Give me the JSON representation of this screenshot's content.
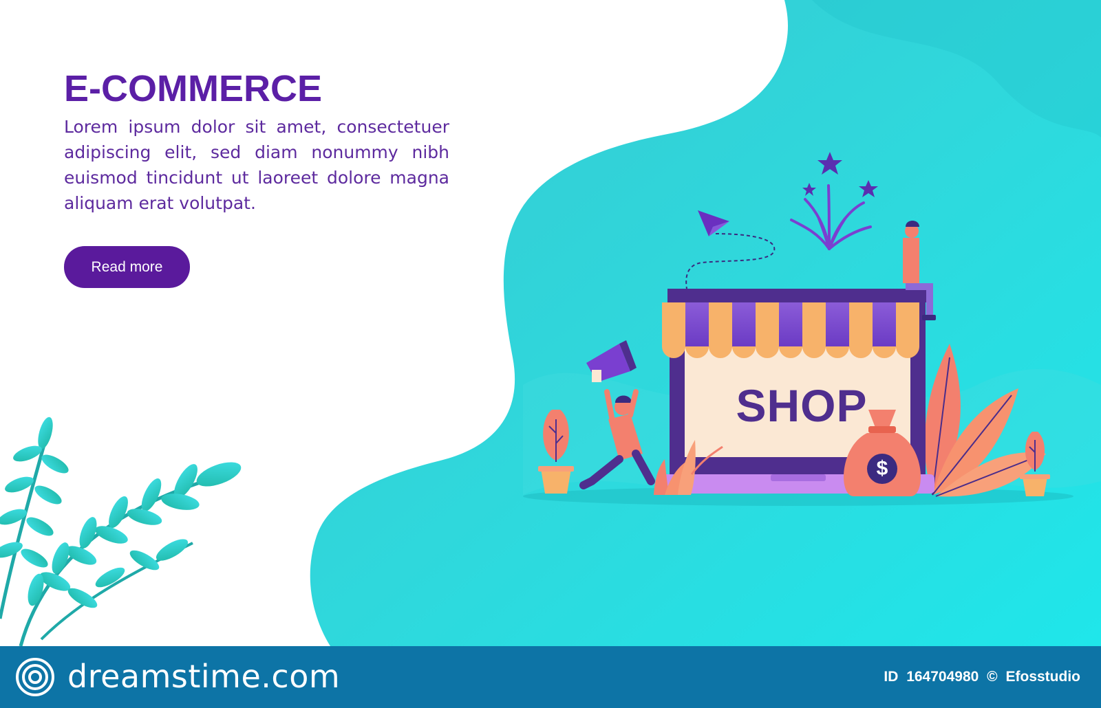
{
  "hero": {
    "headline": "E-COMMERCE",
    "body": "Lorem ipsum dolor sit amet, consectetuer adipiscing elit, sed diam nonummy nibh euismod tincidunt ut laoreet dolore magna aliquam erat volutpat.",
    "cta_label": "Read more"
  },
  "illustration": {
    "shop_sign": "SHOP",
    "money_symbol": "$"
  },
  "footer": {
    "brand": "dreamstime.com",
    "id_label": "ID",
    "id_number": "164704980",
    "copyright_symbol": "©",
    "author": "Efosstudio"
  },
  "colors": {
    "primary_purple": "#5a1a9c",
    "teal_background": "#2fd4d8",
    "footer_blue": "#0d74a6",
    "awning_orange": "#f7b26a",
    "coral": "#f3806e"
  },
  "icons": [
    "dreamstime-logo-icon",
    "megaphone-icon",
    "paper-plane-icon",
    "star-icon",
    "money-bag-icon",
    "plant-icon",
    "leaf-icon"
  ]
}
